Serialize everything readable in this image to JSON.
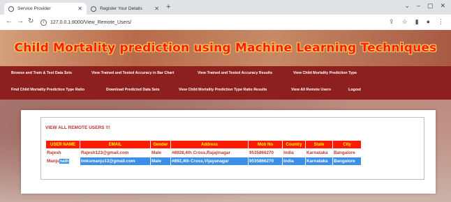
{
  "browser": {
    "tabs": [
      {
        "label": "Service Provider",
        "active": true
      },
      {
        "label": "Register Your Details",
        "active": false
      }
    ],
    "new_tab": "+",
    "url": "127.0.0.1:8000/View_Remote_Users/"
  },
  "site": {
    "title": "Child Mortality prediction using Machine Learning Techniques"
  },
  "menu": {
    "row1": [
      "Browse and Train & Test Data Sets",
      "View Trained and Tested Accuracy in Bar Chart",
      "View Trained and Tested Accuracy Results",
      "View Child Mortality Prediction Type"
    ],
    "row2": [
      "Find Child Mortality Prediction Type Ratio",
      "Download Predicted Data Sets",
      "View Child Mortality Prediction Type Ratio Results",
      "View All Remote Users",
      "Logout"
    ]
  },
  "panel": {
    "heading": "VIEW ALL REMOTE USERS !!!",
    "columns": [
      "USER NAME",
      "EMAIL",
      "Gender",
      "Address",
      "Mob No",
      "Country",
      "State",
      "City"
    ],
    "rows": [
      {
        "name": "Rajesh",
        "email": "Rajesh123@gmail.com",
        "gender": "Male",
        "address": "#8928,4th Cross,Rajajinagar",
        "mob": "9535866270",
        "country": "India",
        "state": "Karnataka",
        "city": "Bangalore"
      },
      {
        "name_visible": "Manju",
        "name_selected": "nath",
        "email": "tmksmanju13@gmail.com",
        "gender": "Male",
        "address": "#892,4th Cross,Vijayanagar",
        "mob": "9535866270",
        "country": "India",
        "state": "Karnataka",
        "city": "Bangalore"
      }
    ]
  },
  "colors": {
    "menu_bg": "#8e1f1f",
    "title_red": "#ff1a1a",
    "header_bg": "#ff1a00",
    "header_text": "#ffff00",
    "selection": "#3b8fe8"
  }
}
